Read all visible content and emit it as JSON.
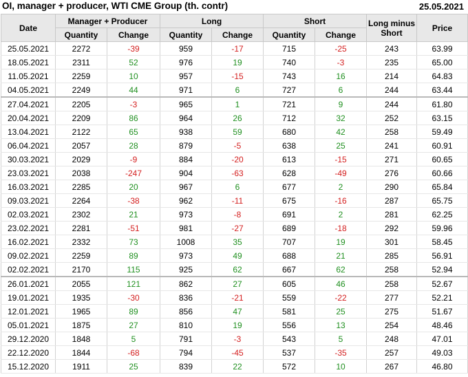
{
  "header": {
    "title": "OI, manager + producer, WTI CME Group (th. contr)",
    "date": "25.05.2021"
  },
  "columns": {
    "date": "Date",
    "group1": "Manager + Producer",
    "group2": "Long",
    "group3": "Short",
    "lms": "Long minus Short",
    "price": "Price",
    "quantity": "Quantity",
    "change": "Change"
  },
  "rows": [
    [
      "25.05.2021",
      "2272",
      "-39",
      "959",
      "-17",
      "715",
      "-25",
      "243",
      "63.99"
    ],
    [
      "18.05.2021",
      "2311",
      "52",
      "976",
      "19",
      "740",
      "-3",
      "235",
      "65.00"
    ],
    [
      "11.05.2021",
      "2259",
      "10",
      "957",
      "-15",
      "743",
      "16",
      "214",
      "64.83"
    ],
    [
      "04.05.2021",
      "2249",
      "44",
      "971",
      "6",
      "727",
      "6",
      "244",
      "63.44"
    ],
    [
      "27.04.2021",
      "2205",
      "-3",
      "965",
      "1",
      "721",
      "9",
      "244",
      "61.80"
    ],
    [
      "20.04.2021",
      "2209",
      "86",
      "964",
      "26",
      "712",
      "32",
      "252",
      "63.15"
    ],
    [
      "13.04.2021",
      "2122",
      "65",
      "938",
      "59",
      "680",
      "42",
      "258",
      "59.49"
    ],
    [
      "06.04.2021",
      "2057",
      "28",
      "879",
      "-5",
      "638",
      "25",
      "241",
      "60.91"
    ],
    [
      "30.03.2021",
      "2029",
      "-9",
      "884",
      "-20",
      "613",
      "-15",
      "271",
      "60.65"
    ],
    [
      "23.03.2021",
      "2038",
      "-247",
      "904",
      "-63",
      "628",
      "-49",
      "276",
      "60.66"
    ],
    [
      "16.03.2021",
      "2285",
      "20",
      "967",
      "6",
      "677",
      "2",
      "290",
      "65.84"
    ],
    [
      "09.03.2021",
      "2264",
      "-38",
      "962",
      "-11",
      "675",
      "-16",
      "287",
      "65.75"
    ],
    [
      "02.03.2021",
      "2302",
      "21",
      "973",
      "-8",
      "691",
      "2",
      "281",
      "62.25"
    ],
    [
      "23.02.2021",
      "2281",
      "-51",
      "981",
      "-27",
      "689",
      "-18",
      "292",
      "59.96"
    ],
    [
      "16.02.2021",
      "2332",
      "73",
      "1008",
      "35",
      "707",
      "19",
      "301",
      "58.45"
    ],
    [
      "09.02.2021",
      "2259",
      "89",
      "973",
      "49",
      "688",
      "21",
      "285",
      "56.91"
    ],
    [
      "02.02.2021",
      "2170",
      "115",
      "925",
      "62",
      "667",
      "62",
      "258",
      "52.94"
    ],
    [
      "26.01.2021",
      "2055",
      "121",
      "862",
      "27",
      "605",
      "46",
      "258",
      "52.67"
    ],
    [
      "19.01.2021",
      "1935",
      "-30",
      "836",
      "-21",
      "559",
      "-22",
      "277",
      "52.21"
    ],
    [
      "12.01.2021",
      "1965",
      "89",
      "856",
      "47",
      "581",
      "25",
      "275",
      "51.67"
    ],
    [
      "05.01.2021",
      "1875",
      "27",
      "810",
      "19",
      "556",
      "13",
      "254",
      "48.46"
    ],
    [
      "29.12.2020",
      "1848",
      "5",
      "791",
      "-3",
      "543",
      "5",
      "248",
      "47.01"
    ],
    [
      "22.12.2020",
      "1844",
      "-68",
      "794",
      "-45",
      "537",
      "-35",
      "257",
      "49.03"
    ],
    [
      "15.12.2020",
      "1911",
      "25",
      "839",
      "22",
      "572",
      "10",
      "267",
      "46.80"
    ]
  ],
  "separator_before_rows": [
    4,
    17
  ],
  "colors": {
    "positive": "#1f8f1f",
    "negative": "#d42020",
    "header_bg": "#e8e8e8"
  }
}
